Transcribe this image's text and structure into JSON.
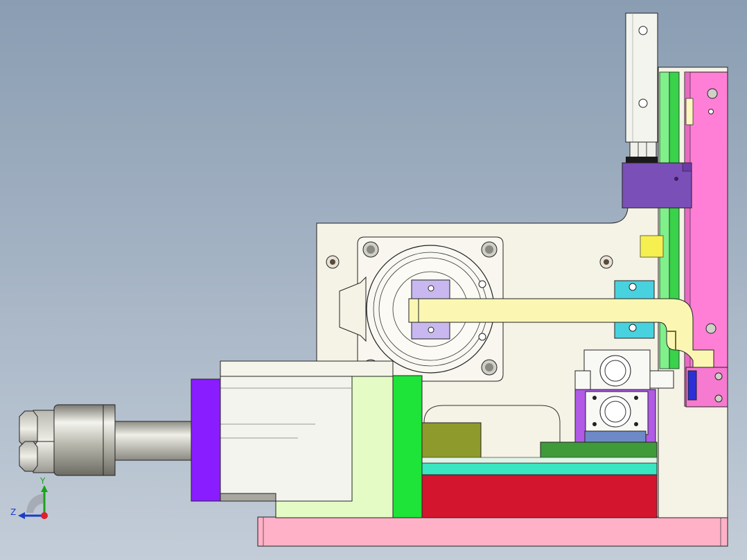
{
  "viewport": {
    "description_free": true,
    "background_top": "#8a9db2",
    "background_bottom": "#c3cdd8"
  },
  "triad": {
    "y_label": "Y",
    "z_label": "Z",
    "y_color": "#1aa31a",
    "z_color": "#1a3cc8",
    "origin_color": "#e0202a"
  },
  "palette": {
    "base_plate": "#ffb1c8",
    "side_plate": "#f5f2e6",
    "magenta_plate": "#ff7fd6",
    "violet_flange": "#8a1dff",
    "light_green": "#e4fbc6",
    "bright_green": "#1ee43a",
    "olive": "#8f9a2c",
    "dark_green": "#3f9a3a",
    "teal": "#39e6c2",
    "red_block": "#d3152e",
    "cream_arm": "#fbf7b3",
    "purple_block": "#7b4fb8",
    "yellow_pad": "#f5f050",
    "cyan_clip": "#48d2e0",
    "lavender": "#c8b8ef"
  }
}
